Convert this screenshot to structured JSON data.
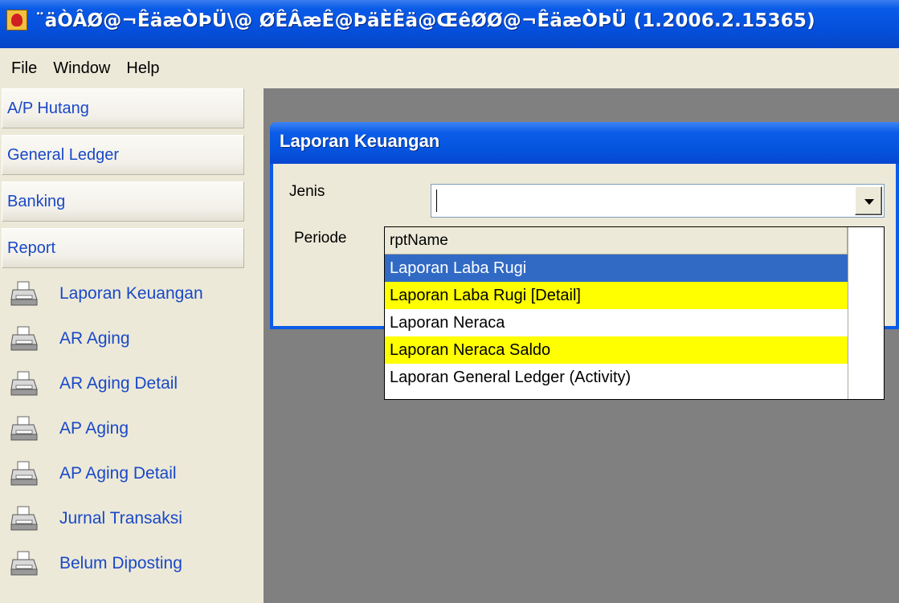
{
  "window": {
    "title": "¨äÒÂØ@¬ÊäæÒÞÜ\\@ ØÊÂæÊ@ÞäÈÊä@ŒêØØ@¬ÊäæÒÞÜ (1.2006.2.15365)"
  },
  "menu": [
    "File",
    "Window",
    "Help"
  ],
  "sidebar": {
    "sections": [
      "A/P Hutang",
      "General Ledger",
      "Banking",
      "Report"
    ],
    "reports": [
      "Laporan Keuangan",
      "AR Aging",
      "AR Aging Detail",
      "AP Aging",
      "AP Aging Detail",
      "Jurnal Transaksi",
      "Belum Diposting"
    ]
  },
  "child_window": {
    "title": "Laporan Keuangan",
    "jenis_label": "Jenis",
    "periode_label": "Periode",
    "jenis_value": ""
  },
  "dropdown": {
    "header": "rptName",
    "items": [
      "Laporan Laba Rugi",
      "Laporan Laba Rugi [Detail]",
      "Laporan Neraca",
      "Laporan Neraca Saldo",
      "Laporan General Ledger (Activity)"
    ]
  },
  "colors": {
    "title_bar": "#0550dc",
    "link_text": "#1948c8",
    "selection": "#316ac5",
    "highlight_row": "#ffff00",
    "mdi_background": "#808080"
  }
}
